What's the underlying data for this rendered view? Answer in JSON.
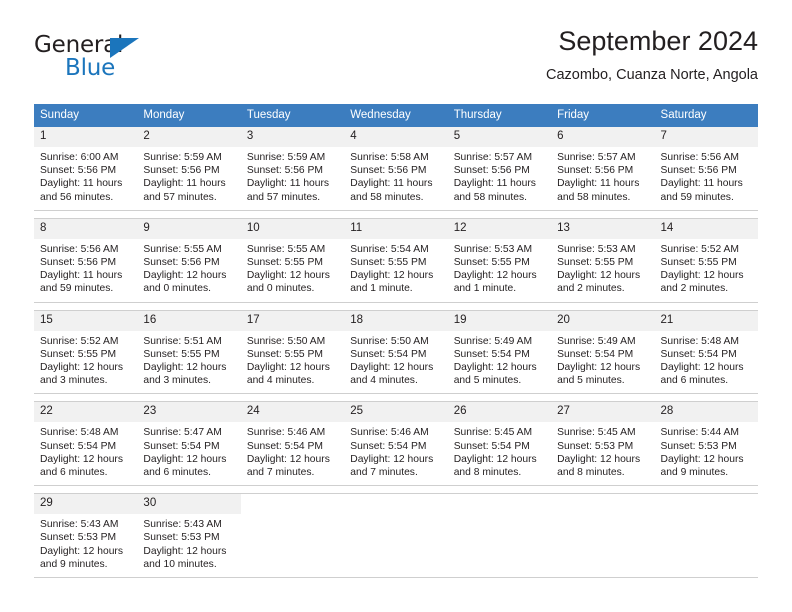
{
  "brand": {
    "name_part1": "General",
    "name_part2": "Blue",
    "accent_color": "#1b75bc"
  },
  "header": {
    "title": "September 2024",
    "subtitle": "Cazombo, Cuanza Norte, Angola"
  },
  "calendar": {
    "header_color": "#3c7dbf",
    "weekdays": [
      "Sunday",
      "Monday",
      "Tuesday",
      "Wednesday",
      "Thursday",
      "Friday",
      "Saturday"
    ],
    "weeks": [
      [
        {
          "day": "1",
          "sunrise": "Sunrise: 6:00 AM",
          "sunset": "Sunset: 5:56 PM",
          "daylight": "Daylight: 11 hours and 56 minutes."
        },
        {
          "day": "2",
          "sunrise": "Sunrise: 5:59 AM",
          "sunset": "Sunset: 5:56 PM",
          "daylight": "Daylight: 11 hours and 57 minutes."
        },
        {
          "day": "3",
          "sunrise": "Sunrise: 5:59 AM",
          "sunset": "Sunset: 5:56 PM",
          "daylight": "Daylight: 11 hours and 57 minutes."
        },
        {
          "day": "4",
          "sunrise": "Sunrise: 5:58 AM",
          "sunset": "Sunset: 5:56 PM",
          "daylight": "Daylight: 11 hours and 58 minutes."
        },
        {
          "day": "5",
          "sunrise": "Sunrise: 5:57 AM",
          "sunset": "Sunset: 5:56 PM",
          "daylight": "Daylight: 11 hours and 58 minutes."
        },
        {
          "day": "6",
          "sunrise": "Sunrise: 5:57 AM",
          "sunset": "Sunset: 5:56 PM",
          "daylight": "Daylight: 11 hours and 58 minutes."
        },
        {
          "day": "7",
          "sunrise": "Sunrise: 5:56 AM",
          "sunset": "Sunset: 5:56 PM",
          "daylight": "Daylight: 11 hours and 59 minutes."
        }
      ],
      [
        {
          "day": "8",
          "sunrise": "Sunrise: 5:56 AM",
          "sunset": "Sunset: 5:56 PM",
          "daylight": "Daylight: 11 hours and 59 minutes."
        },
        {
          "day": "9",
          "sunrise": "Sunrise: 5:55 AM",
          "sunset": "Sunset: 5:56 PM",
          "daylight": "Daylight: 12 hours and 0 minutes."
        },
        {
          "day": "10",
          "sunrise": "Sunrise: 5:55 AM",
          "sunset": "Sunset: 5:55 PM",
          "daylight": "Daylight: 12 hours and 0 minutes."
        },
        {
          "day": "11",
          "sunrise": "Sunrise: 5:54 AM",
          "sunset": "Sunset: 5:55 PM",
          "daylight": "Daylight: 12 hours and 1 minute."
        },
        {
          "day": "12",
          "sunrise": "Sunrise: 5:53 AM",
          "sunset": "Sunset: 5:55 PM",
          "daylight": "Daylight: 12 hours and 1 minute."
        },
        {
          "day": "13",
          "sunrise": "Sunrise: 5:53 AM",
          "sunset": "Sunset: 5:55 PM",
          "daylight": "Daylight: 12 hours and 2 minutes."
        },
        {
          "day": "14",
          "sunrise": "Sunrise: 5:52 AM",
          "sunset": "Sunset: 5:55 PM",
          "daylight": "Daylight: 12 hours and 2 minutes."
        }
      ],
      [
        {
          "day": "15",
          "sunrise": "Sunrise: 5:52 AM",
          "sunset": "Sunset: 5:55 PM",
          "daylight": "Daylight: 12 hours and 3 minutes."
        },
        {
          "day": "16",
          "sunrise": "Sunrise: 5:51 AM",
          "sunset": "Sunset: 5:55 PM",
          "daylight": "Daylight: 12 hours and 3 minutes."
        },
        {
          "day": "17",
          "sunrise": "Sunrise: 5:50 AM",
          "sunset": "Sunset: 5:55 PM",
          "daylight": "Daylight: 12 hours and 4 minutes."
        },
        {
          "day": "18",
          "sunrise": "Sunrise: 5:50 AM",
          "sunset": "Sunset: 5:54 PM",
          "daylight": "Daylight: 12 hours and 4 minutes."
        },
        {
          "day": "19",
          "sunrise": "Sunrise: 5:49 AM",
          "sunset": "Sunset: 5:54 PM",
          "daylight": "Daylight: 12 hours and 5 minutes."
        },
        {
          "day": "20",
          "sunrise": "Sunrise: 5:49 AM",
          "sunset": "Sunset: 5:54 PM",
          "daylight": "Daylight: 12 hours and 5 minutes."
        },
        {
          "day": "21",
          "sunrise": "Sunrise: 5:48 AM",
          "sunset": "Sunset: 5:54 PM",
          "daylight": "Daylight: 12 hours and 6 minutes."
        }
      ],
      [
        {
          "day": "22",
          "sunrise": "Sunrise: 5:48 AM",
          "sunset": "Sunset: 5:54 PM",
          "daylight": "Daylight: 12 hours and 6 minutes."
        },
        {
          "day": "23",
          "sunrise": "Sunrise: 5:47 AM",
          "sunset": "Sunset: 5:54 PM",
          "daylight": "Daylight: 12 hours and 6 minutes."
        },
        {
          "day": "24",
          "sunrise": "Sunrise: 5:46 AM",
          "sunset": "Sunset: 5:54 PM",
          "daylight": "Daylight: 12 hours and 7 minutes."
        },
        {
          "day": "25",
          "sunrise": "Sunrise: 5:46 AM",
          "sunset": "Sunset: 5:54 PM",
          "daylight": "Daylight: 12 hours and 7 minutes."
        },
        {
          "day": "26",
          "sunrise": "Sunrise: 5:45 AM",
          "sunset": "Sunset: 5:54 PM",
          "daylight": "Daylight: 12 hours and 8 minutes."
        },
        {
          "day": "27",
          "sunrise": "Sunrise: 5:45 AM",
          "sunset": "Sunset: 5:53 PM",
          "daylight": "Daylight: 12 hours and 8 minutes."
        },
        {
          "day": "28",
          "sunrise": "Sunrise: 5:44 AM",
          "sunset": "Sunset: 5:53 PM",
          "daylight": "Daylight: 12 hours and 9 minutes."
        }
      ],
      [
        {
          "day": "29",
          "sunrise": "Sunrise: 5:43 AM",
          "sunset": "Sunset: 5:53 PM",
          "daylight": "Daylight: 12 hours and 9 minutes."
        },
        {
          "day": "30",
          "sunrise": "Sunrise: 5:43 AM",
          "sunset": "Sunset: 5:53 PM",
          "daylight": "Daylight: 12 hours and 10 minutes."
        },
        {
          "day": "",
          "sunrise": "",
          "sunset": "",
          "daylight": ""
        },
        {
          "day": "",
          "sunrise": "",
          "sunset": "",
          "daylight": ""
        },
        {
          "day": "",
          "sunrise": "",
          "sunset": "",
          "daylight": ""
        },
        {
          "day": "",
          "sunrise": "",
          "sunset": "",
          "daylight": ""
        },
        {
          "day": "",
          "sunrise": "",
          "sunset": "",
          "daylight": ""
        }
      ]
    ]
  }
}
